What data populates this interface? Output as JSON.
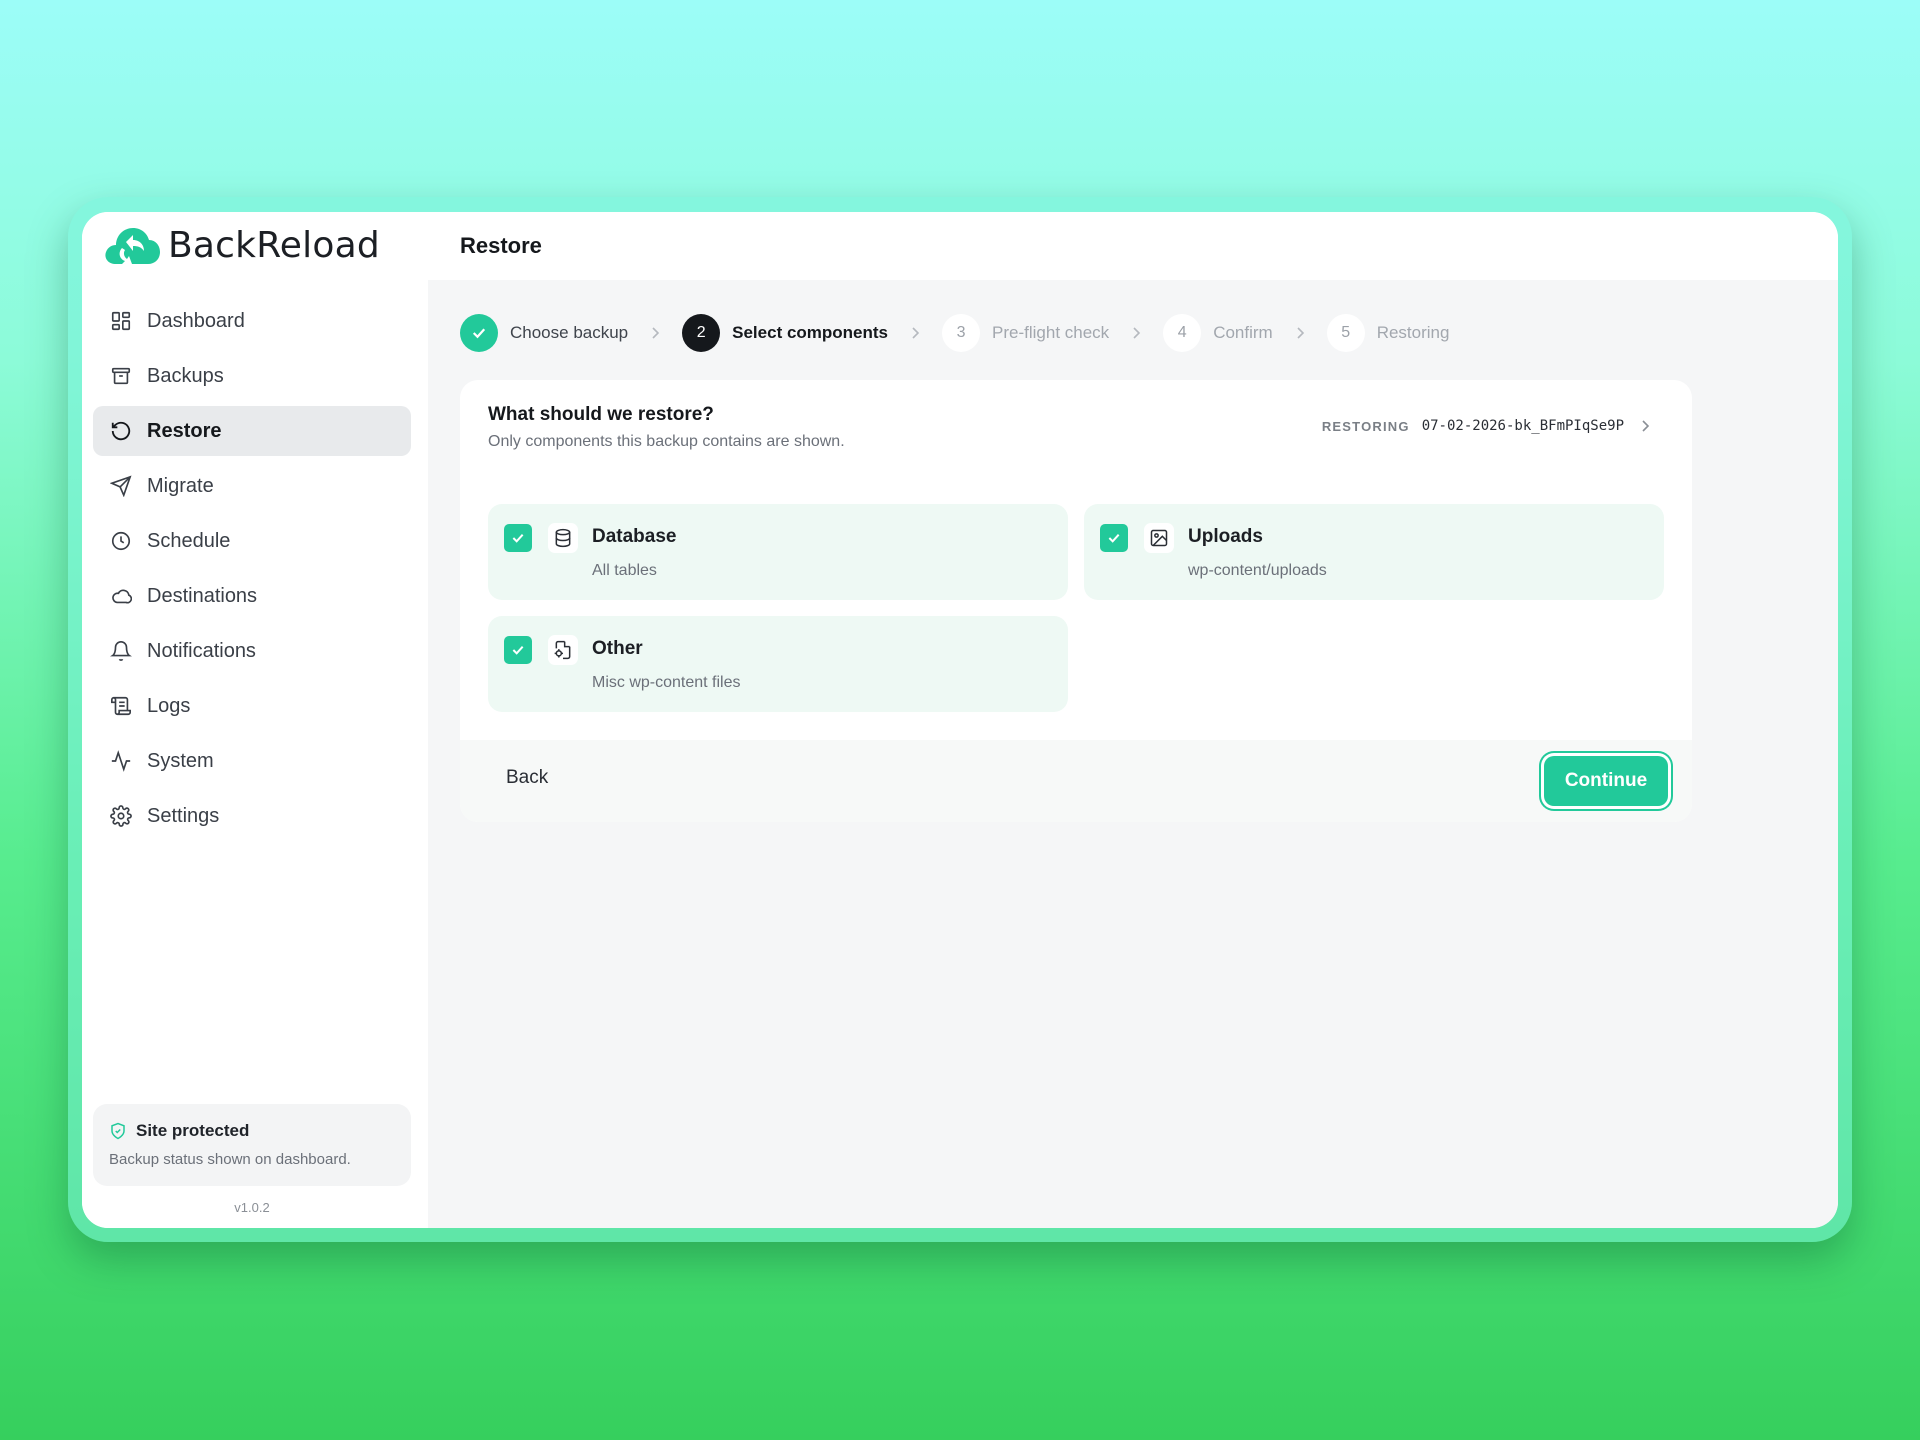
{
  "app": {
    "name": "BackReload",
    "version": "v1.0.2"
  },
  "colors": {
    "accent": "#22c99a",
    "sidebar_active": "#e8eaec",
    "component_bg": "#eef9f4",
    "dark": "#15181c"
  },
  "sidebar": {
    "items": [
      {
        "label": "Dashboard",
        "icon": "dashboard-icon"
      },
      {
        "label": "Backups",
        "icon": "archive-icon"
      },
      {
        "label": "Restore",
        "icon": "restore-icon",
        "active": true
      },
      {
        "label": "Migrate",
        "icon": "send-icon"
      },
      {
        "label": "Schedule",
        "icon": "clock-icon"
      },
      {
        "label": "Destinations",
        "icon": "cloud-icon"
      },
      {
        "label": "Notifications",
        "icon": "bell-icon"
      },
      {
        "label": "Logs",
        "icon": "scroll-icon"
      },
      {
        "label": "System",
        "icon": "activity-icon"
      },
      {
        "label": "Settings",
        "icon": "gear-icon"
      }
    ],
    "status": {
      "title": "Site protected",
      "subtitle": "Backup status shown on dashboard."
    }
  },
  "header": {
    "title": "Restore"
  },
  "stepper": {
    "steps": [
      {
        "number": "1",
        "label": "Choose backup",
        "state": "done"
      },
      {
        "number": "2",
        "label": "Select components",
        "state": "current"
      },
      {
        "number": "3",
        "label": "Pre-flight check",
        "state": "todo"
      },
      {
        "number": "4",
        "label": "Confirm",
        "state": "todo"
      },
      {
        "number": "5",
        "label": "Restoring",
        "state": "todo"
      }
    ]
  },
  "card": {
    "title": "What should we restore?",
    "subtitle": "Only components this backup contains are shown.",
    "restoring_label": "RESTORING",
    "restoring_id": "07-02-2026-bk_BFmPIqSe9P",
    "components": [
      {
        "name": "Database",
        "description": "All tables",
        "icon": "database-icon",
        "checked": true
      },
      {
        "name": "Uploads",
        "description": "wp-content/uploads",
        "icon": "image-icon",
        "checked": true
      },
      {
        "name": "Other",
        "description": "Misc wp-content files",
        "icon": "file-cog-icon",
        "checked": true
      }
    ],
    "back_label": "Back",
    "continue_label": "Continue"
  }
}
